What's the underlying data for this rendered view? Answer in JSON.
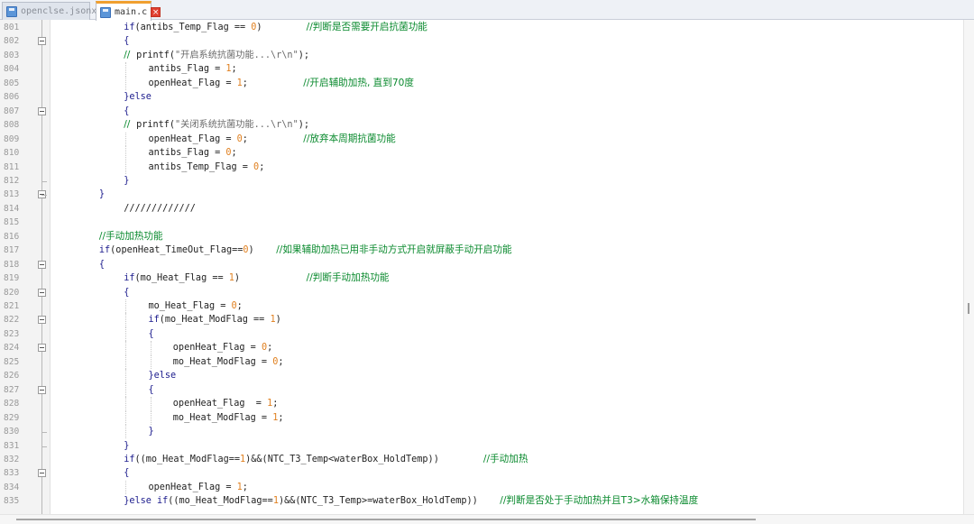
{
  "tabs": [
    {
      "label": "openclse.jsonx",
      "active": false
    },
    {
      "label": "main.c",
      "active": true
    }
  ],
  "first_line": 801,
  "lines": [
    {
      "indent": 4,
      "html": "<span class=\"kw\">if</span>(antibs_Temp_Flag == <span class=\"num\">0</span>)        <span class=\"cm\">//判断是否需要开启抗菌功能</span>"
    },
    {
      "indent": 4,
      "html": "<span class=\"kw\">{</span>"
    },
    {
      "indent": 4,
      "html": "<span class=\"cm\">//  </span>printf(<span class=\"str\">\"开启系统抗菌功能...\\r\\n\"</span>);"
    },
    {
      "indent": 5,
      "html": "antibs_Flag = <span class=\"num\">1</span>;"
    },
    {
      "indent": 5,
      "html": "openHeat_Flag = <span class=\"num\">1</span>;          <span class=\"cm\">//开启辅助加热, 直到70度</span>"
    },
    {
      "indent": 4,
      "html": "<span class=\"kw\">}else</span>"
    },
    {
      "indent": 4,
      "html": "<span class=\"kw\">{</span>"
    },
    {
      "indent": 4,
      "html": "<span class=\"cm\">//  </span>printf(<span class=\"str\">\"关闭系统抗菌功能...\\r\\n\"</span>);"
    },
    {
      "indent": 5,
      "html": "openHeat_Flag = <span class=\"num\">0</span>;          <span class=\"cm\">//放弃本周期抗菌功能</span>"
    },
    {
      "indent": 5,
      "html": "antibs_Flag = <span class=\"num\">0</span>;"
    },
    {
      "indent": 5,
      "html": "antibs_Temp_Flag = <span class=\"num\">0</span>;"
    },
    {
      "indent": 4,
      "html": "<span class=\"kw\">}</span>"
    },
    {
      "indent": 3,
      "html": "<span class=\"kw\">}</span>"
    },
    {
      "indent": 4,
      "html": "/////////////"
    },
    {
      "indent": 3,
      "html": ""
    },
    {
      "indent": 3,
      "html": "<span class=\"cm\">//手动加热功能</span>"
    },
    {
      "indent": 3,
      "html": "<span class=\"kw\">if</span>(openHeat_TimeOut_Flag==<span class=\"num\">0</span>)    <span class=\"cm\">//如果辅助加热已用非手动方式开启就屏蔽手动开启功能</span>"
    },
    {
      "indent": 3,
      "html": "<span class=\"kw\">{</span>"
    },
    {
      "indent": 4,
      "html": "<span class=\"kw\">if</span>(mo_Heat_Flag == <span class=\"num\">1</span>)            <span class=\"cm\">//判断手动加热功能</span>"
    },
    {
      "indent": 4,
      "html": "<span class=\"kw\">{</span>"
    },
    {
      "indent": 5,
      "html": "mo_Heat_Flag = <span class=\"num\">0</span>;"
    },
    {
      "indent": 5,
      "html": "<span class=\"kw\">if</span>(mo_Heat_ModFlag == <span class=\"num\">1</span>)"
    },
    {
      "indent": 5,
      "html": "<span class=\"kw\">{</span>"
    },
    {
      "indent": 6,
      "html": "openHeat_Flag = <span class=\"num\">0</span>;"
    },
    {
      "indent": 6,
      "html": "mo_Heat_ModFlag = <span class=\"num\">0</span>;"
    },
    {
      "indent": 5,
      "html": "<span class=\"kw\">}else</span>"
    },
    {
      "indent": 5,
      "html": "<span class=\"kw\">{</span>"
    },
    {
      "indent": 6,
      "html": "openHeat_Flag  = <span class=\"num\">1</span>;"
    },
    {
      "indent": 6,
      "html": "mo_Heat_ModFlag = <span class=\"num\">1</span>;"
    },
    {
      "indent": 5,
      "html": "<span class=\"kw\">}</span>"
    },
    {
      "indent": 4,
      "html": "<span class=\"kw\">}</span>"
    },
    {
      "indent": 4,
      "html": "<span class=\"kw\">if</span>((mo_Heat_ModFlag==<span class=\"num\">1</span>)&amp;&amp;(NTC_T3_Temp&lt;waterBox_HoldTemp))        <span class=\"cm\">//手动加热</span>"
    },
    {
      "indent": 4,
      "html": "<span class=\"kw\">{</span>"
    },
    {
      "indent": 5,
      "html": "openHeat_Flag = <span class=\"num\">1</span>;"
    },
    {
      "indent": 4,
      "html": "<span class=\"kw\">}else if</span>((mo_Heat_ModFlag==<span class=\"num\">1</span>)&amp;&amp;(NTC_T3_Temp&gt;=waterBox_HoldTemp))    <span class=\"cm\">//判断是否处于手动加热并且T3&gt;水箱保持温度</span>"
    }
  ],
  "folds": [
    802,
    807,
    813,
    818,
    820,
    822,
    824,
    827,
    833
  ],
  "colors": {
    "keyword": "#1a1a8c",
    "number": "#e08020",
    "comment": "#0a8a2e",
    "tab_accent": "#f0a030"
  }
}
